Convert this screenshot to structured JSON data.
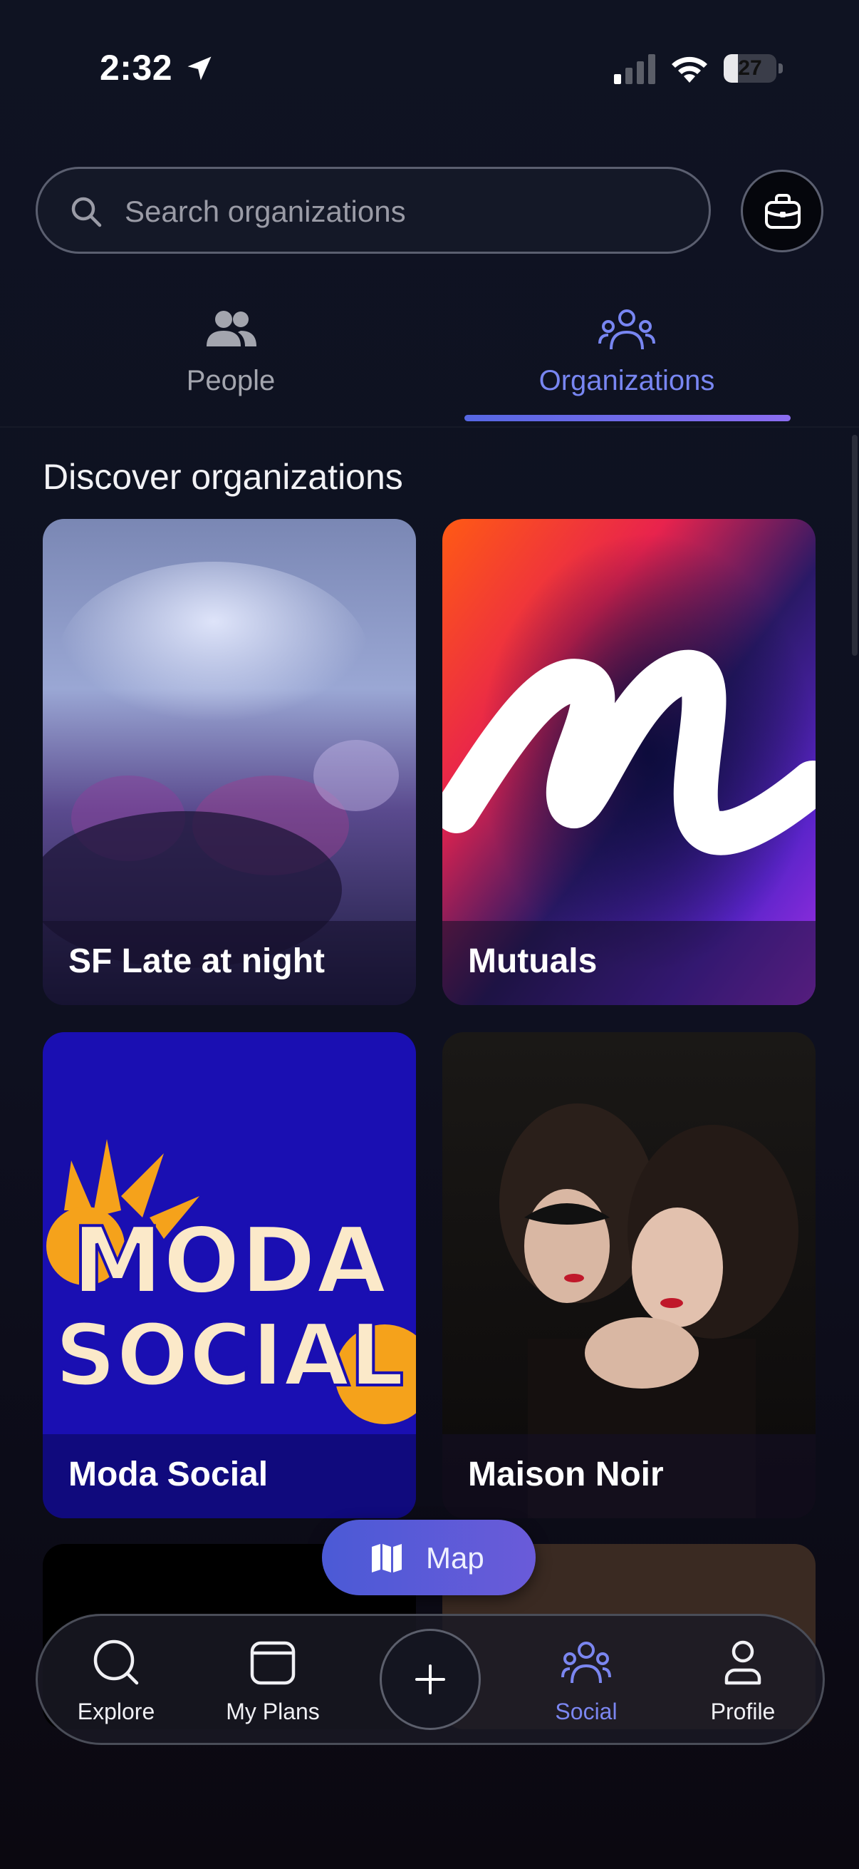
{
  "status_bar": {
    "time": "2:32",
    "battery": "27",
    "battery_level": 0.27
  },
  "search": {
    "placeholder": "Search organizations",
    "value": ""
  },
  "tabs": [
    {
      "label": "People",
      "active": false,
      "icon": "people-icon"
    },
    {
      "label": "Organizations",
      "active": true,
      "icon": "organizations-icon"
    }
  ],
  "section_title": "Discover organizations",
  "organizations": [
    {
      "name": "SF Late at night"
    },
    {
      "name": "Mutuals"
    },
    {
      "name": "Moda Social",
      "logo_text": "MODA SOCIAL"
    },
    {
      "name": "Maison Noir"
    }
  ],
  "map_button": {
    "label": "Map",
    "icon": "map-icon"
  },
  "bottom_nav": [
    {
      "label": "Explore",
      "icon": "search-icon",
      "active": false
    },
    {
      "label": "My Plans",
      "icon": "calendar-icon",
      "active": false
    },
    {
      "label": "",
      "icon": "plus-icon",
      "active": false
    },
    {
      "label": "Social",
      "icon": "social-icon",
      "active": true
    },
    {
      "label": "Profile",
      "icon": "profile-icon",
      "active": false
    }
  ],
  "colors": {
    "accent": "#7886f2",
    "background": "#0d0f1e",
    "moda_blue": "#1a0fb2",
    "moda_orange": "#f5a21b",
    "moda_cream": "#fbe9c9"
  }
}
